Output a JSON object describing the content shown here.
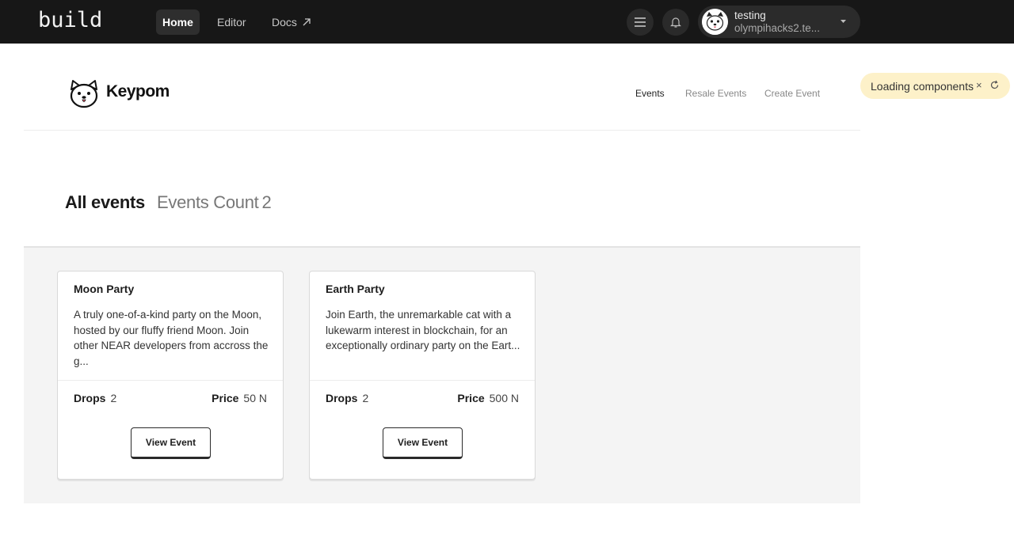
{
  "topbar": {
    "brand": "build",
    "nav": {
      "home": "Home",
      "editor": "Editor",
      "docs": "Docs"
    },
    "icons": {
      "menu": "menu-icon",
      "bell": "bell-icon",
      "external": "external-link-icon",
      "caret": "caret-down-icon"
    },
    "user": {
      "name": "testing",
      "account": "olympihacks2.te..."
    }
  },
  "keypom": {
    "name": "Keypom",
    "nav": {
      "events": "Events",
      "resale": "Resale Events",
      "create": "Create Event"
    }
  },
  "toast": {
    "text": "Loading components",
    "close": "×"
  },
  "events": {
    "title": "All events",
    "count_label": "Events Count",
    "count": "2",
    "cards": [
      {
        "title": "Moon Party",
        "description": "A truly one-of-a-kind party on the Moon, hosted by our fluffy friend Moon. Join other NEAR developers from accross the g...",
        "drops_label": "Drops",
        "drops": "2",
        "price_label": "Price",
        "price": "50 N",
        "button": "View Event"
      },
      {
        "title": "Earth Party",
        "description": "Join Earth, the unremarkable cat with a lukewarm interest in blockchain, for an exceptionally ordinary party on the Eart...",
        "drops_label": "Drops",
        "drops": "2",
        "price_label": "Price",
        "price": "500 N",
        "button": "View Event"
      }
    ]
  },
  "colors": {
    "topbar": "#171717",
    "toast": "#fdf1c9",
    "grid_bg": "#f4f4f4"
  }
}
